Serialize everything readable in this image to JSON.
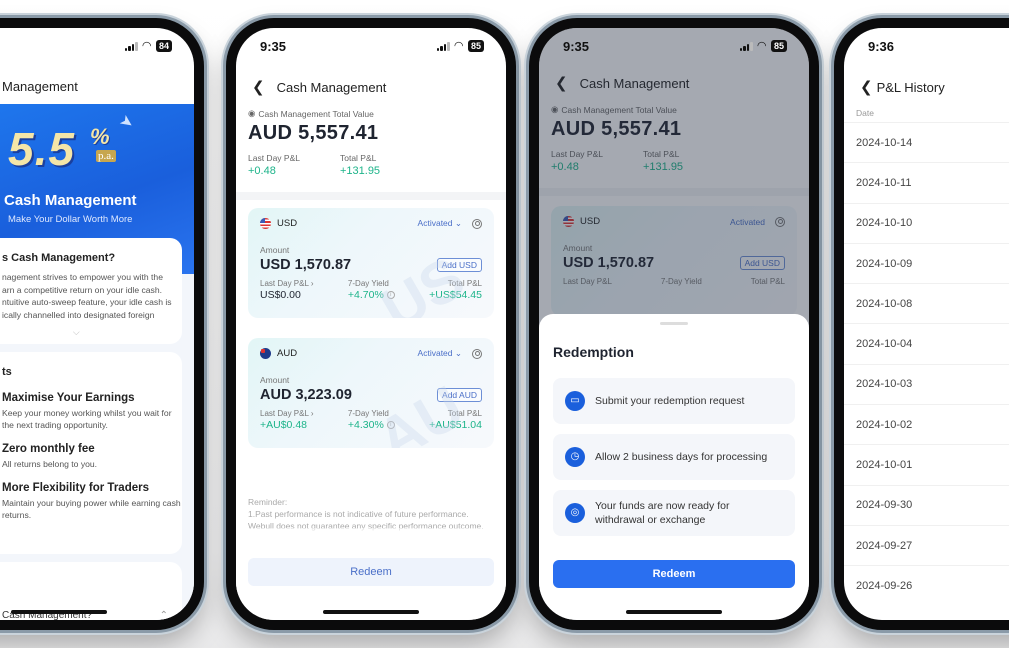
{
  "phone1": {
    "status": {
      "battery": "84"
    },
    "header_title": "Management",
    "hero": {
      "rate": "5.5",
      "percent": "%",
      "period": "p.a.",
      "title": "Cash Management",
      "subtitle": "Make Your Dollar Worth More"
    },
    "what": {
      "heading": "s Cash Management?",
      "lines": [
        "nagement strives to empower you with the",
        "arn a competitive return on your idle cash.",
        "ntuitive auto-sweep feature, your idle cash is",
        "ically channelled into designated foreign"
      ]
    },
    "benefits": {
      "heading": "ts",
      "items": [
        {
          "title": "Maximise Your Earnings",
          "desc": "Keep your money working whilst you wait for the next trading opportunity."
        },
        {
          "title": "Zero monthly fee",
          "desc": "All returns belong to you."
        },
        {
          "title": "More Flexibility for Traders",
          "desc": "Maintain your buying power while earning cash returns."
        }
      ]
    },
    "faq_question": "Cash Management?"
  },
  "phone2": {
    "status": {
      "time": "9:35",
      "battery": "85"
    },
    "nav_title": "Cash Management",
    "total_label": "Cash Management Total Value",
    "total_value": "AUD 5,557.41",
    "last_day_label": "Last Day P&L",
    "last_day_value": "+0.48",
    "total_pl_label": "Total P&L",
    "total_pl_value": "+131.95",
    "accounts": [
      {
        "currency": "USD",
        "status": "Activated",
        "amount_label": "Amount",
        "amount": "USD 1,570.87",
        "add_label": "Add USD",
        "last_day_label": "Last Day P&L",
        "last_day": "US$0.00",
        "yield_label": "7-Day Yield",
        "yield": "+4.70%",
        "total_label": "Total P&L",
        "total": "+US$54.45",
        "watermark": "US"
      },
      {
        "currency": "AUD",
        "status": "Activated",
        "amount_label": "Amount",
        "amount": "AUD 3,223.09",
        "add_label": "Add AUD",
        "last_day_label": "Last Day P&L",
        "last_day": "+AU$0.48",
        "yield_label": "7-Day Yield",
        "yield": "+4.30%",
        "total_label": "Total P&L",
        "total": "+AU$51.04",
        "watermark": "AU"
      }
    ],
    "reminder": {
      "title": "Reminder:",
      "text": "1.Past performance is not indicative of future performance. Webull does not guarantee any specific performance outcome."
    },
    "redeem_label": "Redeem"
  },
  "phone3": {
    "status": {
      "time": "9:35",
      "battery": "85"
    },
    "sheet_title": "Redemption",
    "steps": [
      {
        "icon": "card-icon",
        "text": "Submit your redemption request"
      },
      {
        "icon": "clock-icon",
        "text": "Allow 2 business days for processing"
      },
      {
        "icon": "money-icon",
        "text": "Your funds are now ready for withdrawal or exchange"
      }
    ],
    "redeem_label": "Redeem"
  },
  "phone4": {
    "status": {
      "time": "9:36"
    },
    "nav_title": "P&L History",
    "column_header": "Date",
    "dates": [
      "2024-10-14",
      "2024-10-11",
      "2024-10-10",
      "2024-10-09",
      "2024-10-08",
      "2024-10-04",
      "2024-10-03",
      "2024-10-02",
      "2024-10-01",
      "2024-09-30",
      "2024-09-27",
      "2024-09-26"
    ]
  },
  "colors": {
    "accent_blue": "#2a6ff0",
    "gain_green": "#1db48a",
    "link_blue": "#4a6fc8"
  }
}
